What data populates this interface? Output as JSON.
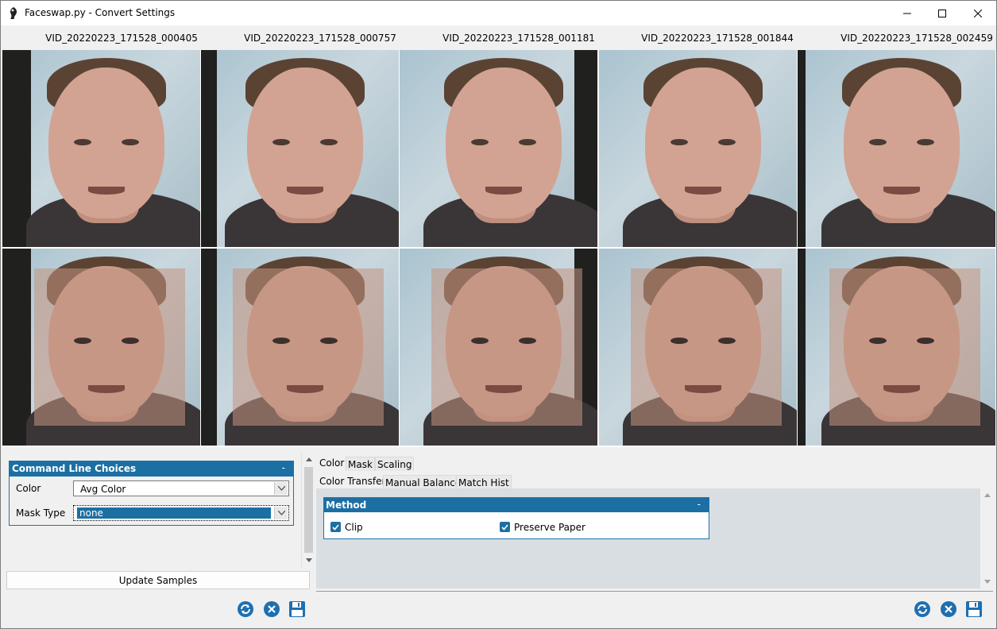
{
  "window": {
    "title": "Faceswap.py - Convert Settings",
    "controls": [
      "minimize-icon",
      "maximize-icon",
      "close-icon"
    ]
  },
  "frames": [
    {
      "name": "VID_20220223_171528_000405"
    },
    {
      "name": "VID_20220223_171528_000757"
    },
    {
      "name": "VID_20220223_171528_001181"
    },
    {
      "name": "VID_20220223_171528_001844"
    },
    {
      "name": "VID_20220223_171528_002459"
    }
  ],
  "command_line": {
    "title": "Command Line Choices",
    "collapse": "-",
    "color_label": "Color",
    "color_value": "Avg Color",
    "mask_label": "Mask Type",
    "mask_value": "none"
  },
  "update_button": "Update Samples",
  "left_buttons": [
    "refresh-icon",
    "reset-icon",
    "save-icon"
  ],
  "right_buttons": [
    "refresh-icon",
    "reset-icon",
    "save-icon"
  ],
  "tabs": {
    "top": [
      "Color",
      "Mask",
      "Scaling"
    ],
    "sub": [
      "Color Transfer",
      "Manual Balance",
      "Match Hist"
    ]
  },
  "method": {
    "title": "Method",
    "collapse": "-",
    "options": [
      {
        "label": "Clip",
        "checked": true
      },
      {
        "label": "Preserve Paper",
        "checked": true
      }
    ]
  },
  "colors": {
    "accent": "#1c6fa3",
    "panel_bg": "#d9dee2",
    "window_bg": "#f0f0f0"
  }
}
